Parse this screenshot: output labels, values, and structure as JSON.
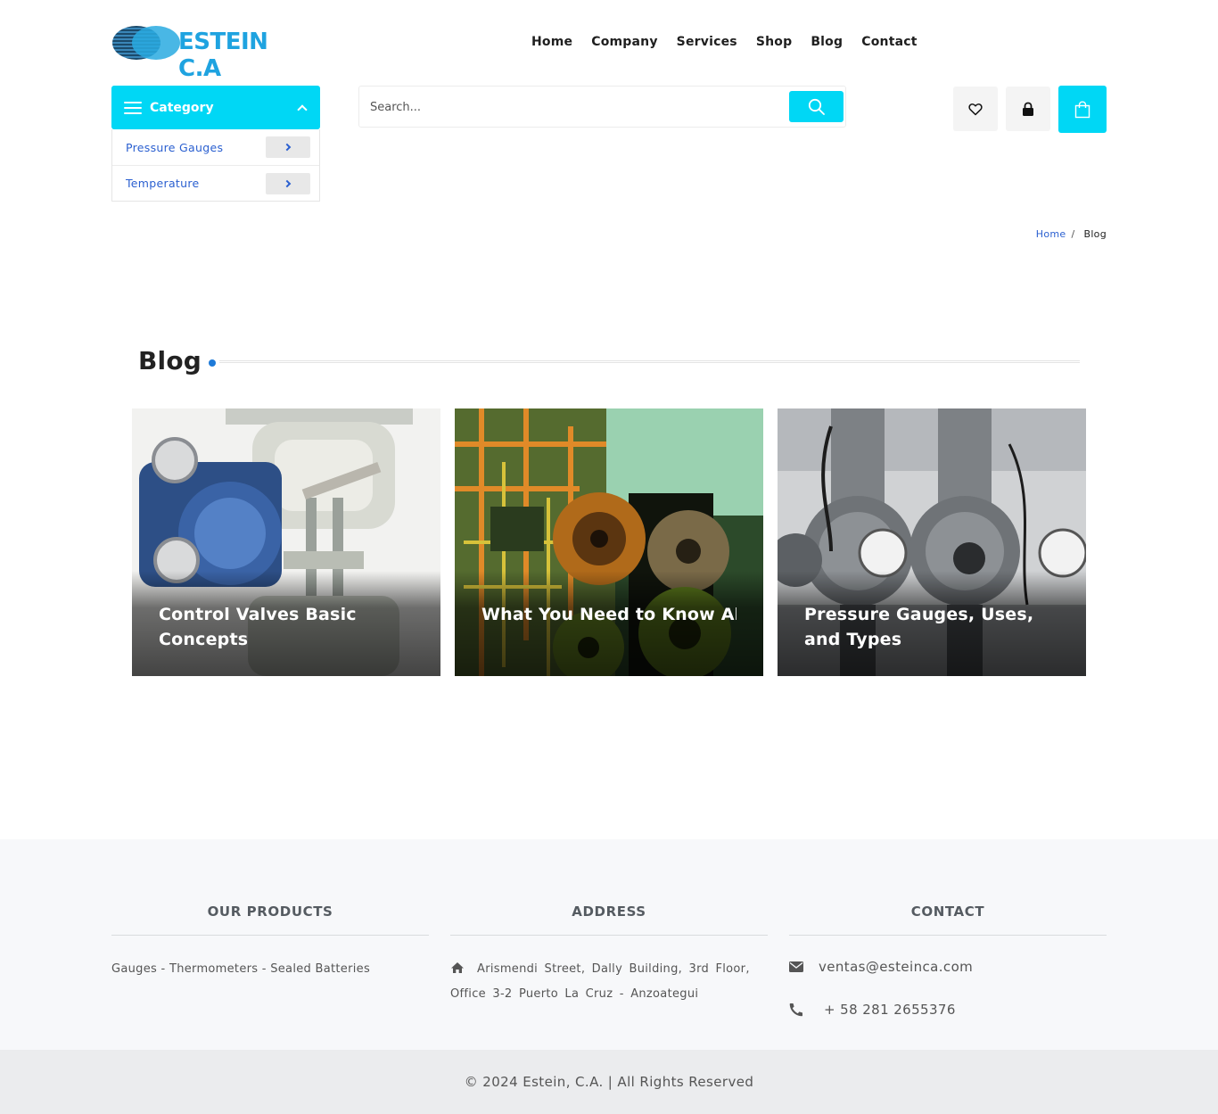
{
  "brand": {
    "logo_text": "ESTEIN C.A",
    "accent_color": "#00d7f5",
    "link_color": "#2a5fd0"
  },
  "nav": {
    "items": [
      {
        "label": "Home"
      },
      {
        "label": "Company"
      },
      {
        "label": "Services"
      },
      {
        "label": "Shop"
      },
      {
        "label": "Blog"
      },
      {
        "label": "Contact"
      }
    ]
  },
  "category": {
    "title": "Category",
    "items": [
      {
        "label": "Pressure Gauges"
      },
      {
        "label": "Temperature"
      }
    ]
  },
  "search": {
    "placeholder": "Search..."
  },
  "actions": {
    "wishlist_icon": "heart-icon",
    "account_icon": "lock-icon",
    "cart_icon": "shopping-bag-icon"
  },
  "breadcrumb": {
    "home": "Home",
    "separator": "/",
    "current": "Blog"
  },
  "blog": {
    "heading": "Blog",
    "posts": [
      {
        "title": "Control Valves Basic Concepts"
      },
      {
        "title": "What You Need to Know About Pressure Gauge…"
      },
      {
        "title": "Pressure Gauges, Uses, and Types"
      }
    ]
  },
  "footer": {
    "products": {
      "heading": "OUR PRODUCTS",
      "text": "Gauges - Thermometers - Sealed Batteries"
    },
    "address": {
      "heading": "ADDRESS",
      "text": "Arismendi Street, Dally Building, 3rd Floor, Office 3-2 Puerto La Cruz - Anzoategui"
    },
    "contact": {
      "heading": "CONTACT",
      "email": "ventas@esteinca.com",
      "phone": "+ 58 281 2655376"
    },
    "copyright": "© 2024 Estein, C.A. | All Rights Reserved"
  }
}
